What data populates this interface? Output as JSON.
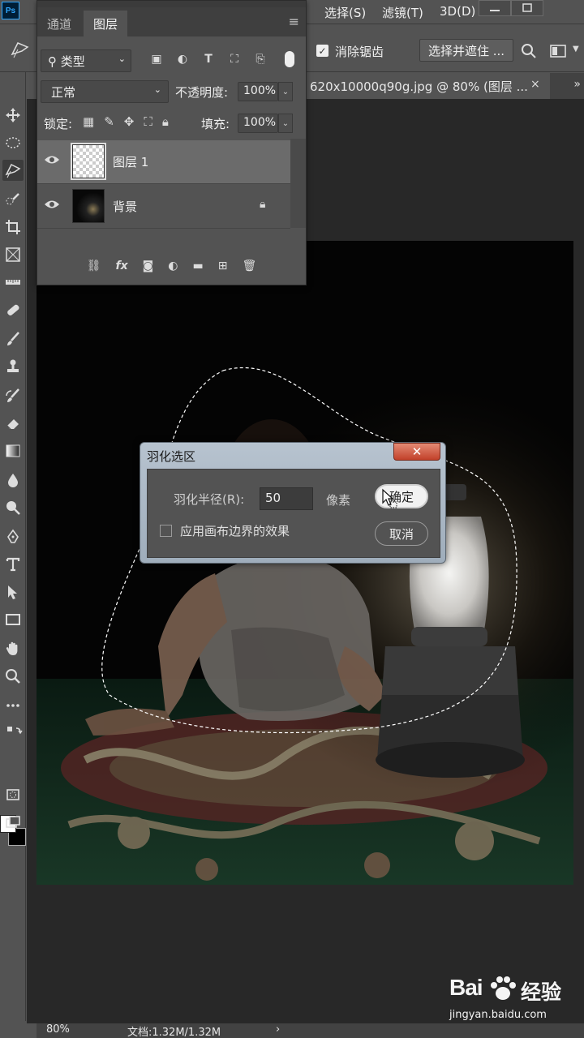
{
  "menubar": {
    "items": [
      "选择(S)",
      "滤镜(T)",
      "3D(D)"
    ],
    "window_buttons": [
      "minimize",
      "maximize"
    ]
  },
  "options": {
    "antialias_label": "消除锯齿",
    "antialias_checked": true,
    "select_mask_label": "选择并遮住 ..."
  },
  "document": {
    "tab_title": "620x10000q90g.jpg @ 80% (图层 ...",
    "close_glyph": "×",
    "more_glyph": "»"
  },
  "layers_panel": {
    "tabs": [
      "通道",
      "图层"
    ],
    "active_tab": "图层",
    "filter_kind": "类型",
    "blend_mode": "正常",
    "opacity_label": "不透明度:",
    "opacity_value": "100%",
    "lock_label": "锁定:",
    "fill_label": "填充:",
    "fill_value": "100%",
    "layers": [
      {
        "name": "图层 1",
        "selected": true,
        "visible": true,
        "locked": false
      },
      {
        "name": "背景",
        "selected": false,
        "visible": true,
        "locked": true
      }
    ],
    "footer_icons": [
      "link-icon",
      "fx-icon",
      "mask-icon",
      "adjustment-icon",
      "folder-icon",
      "new-layer-icon",
      "trash-icon"
    ]
  },
  "dialog": {
    "title": "羽化选区",
    "close_glyph": "✕",
    "radius_label": "羽化半径(R):",
    "radius_value": "50",
    "unit_label": "像素",
    "edge_checkbox_label": "应用画布边界的效果",
    "edge_checkbox_checked": false,
    "ok_label": "确定",
    "cancel_label": "取消"
  },
  "status": {
    "zoom": "80%",
    "doc_info": "文档:1.32M/1.32M",
    "arrow": "›"
  },
  "watermark": {
    "logo": "Bai",
    "logo_cn": "经验",
    "url": "jingyan.baidu.com"
  },
  "colors": {
    "ui_bg": "#535353",
    "canvas_bg": "#282828",
    "dialog_frame": "#a9b6c3",
    "close_red": "#c94a33",
    "ps_blue": "#31a8ff"
  }
}
